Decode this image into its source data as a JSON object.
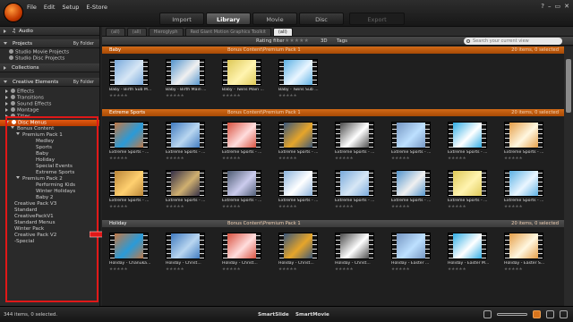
{
  "menu": [
    "File",
    "Edit",
    "Setup",
    "E-Store"
  ],
  "mode_tabs": [
    "Import",
    "Library",
    "Movie",
    "Disc",
    "Export"
  ],
  "sidebar": {
    "audio": "Audio",
    "projects_label": "Projects",
    "projects_sort": "By Folder",
    "project_items": [
      "Studio Movie Projects",
      "Studio Disc Projects"
    ],
    "collections": "Collections",
    "creative_label": "Creative Elements",
    "creative_sort": "By Folder",
    "tree": [
      "Effects",
      "Transitions",
      "Sound Effects",
      "Montage",
      "Titles"
    ],
    "disc_menus": "Disc Menus",
    "bonus_content": "Bonus Content",
    "premium1": "Premium Pack 1",
    "premium1_items": [
      "Medley",
      "Sports",
      "Baby",
      "Holiday",
      "Special Events",
      "Extreme Sports"
    ],
    "premium2": "Premium Pack 2",
    "premium2_items": [
      "Performing Kids",
      "Winter Holidays",
      "Baby 2"
    ],
    "others": [
      "Creative Pack V3",
      "Standard",
      "CreativePackV1",
      "Standard Menus",
      "Winter Pack",
      "Creative Pack V2",
      "-Special"
    ]
  },
  "content_tabs": [
    "(all)",
    "(all)",
    "Hieroglyph",
    "Red Giant Motion Graphics Toolkit",
    "(all)"
  ],
  "filter": {
    "rating_filter": "Rating filter",
    "stars": "★★★★★",
    "three_d": "3D",
    "tags": "Tags",
    "search_placeholder": "Search your current view"
  },
  "sections": [
    {
      "name": "Baby",
      "path": "Bonus Content\\Premium Pack 1",
      "count": "20 items, 0 selected",
      "titles": [
        "Baby - Birth Sub M...",
        "Baby - Birth Main ...",
        "Baby - Twins Main ...",
        "Baby - Twins Sub ..."
      ]
    },
    {
      "name": "Extreme Sports",
      "path": "Bonus Content\\Premium Pack 1",
      "count": "20 items, 0 selected",
      "titles": [
        "Extreme Sports - ...",
        "Extreme Sports - ...",
        "Extreme Sports - ...",
        "Extreme Sports - ...",
        "Extreme Sports - ...",
        "Extreme Sports - ...",
        "Extreme Sports - ...",
        "Extreme Sports - ...",
        "Extreme Sports - ...",
        "Extreme Sports - ...",
        "Extreme Sports - ...",
        "Extreme Sports - ...",
        "Extreme Sports - ...",
        "Extreme Sports - ...",
        "Extreme Sports - ...",
        "Extreme Sports - ..."
      ]
    },
    {
      "name": "Holiday",
      "path": "Bonus Content\\Premium Pack 1",
      "count": "20 items, 0 selected",
      "titles": [
        "Holiday - Chanuka...",
        "Holiday - Christ...",
        "Holiday - Christ...",
        "Holiday - Christ...",
        "Holiday - Christ...",
        "Holiday - Easter ...",
        "Holiday - Easter M...",
        "Holiday - Easter S..."
      ]
    }
  ],
  "rating_stars": "★★★★★",
  "status": "344 items, 0 selected.",
  "bottom": {
    "smartslide": "SmartSlide",
    "smartmovie": "SmartMovie"
  },
  "colors": {
    "accent": "#d8741c",
    "highlight_box": "#e01818"
  }
}
